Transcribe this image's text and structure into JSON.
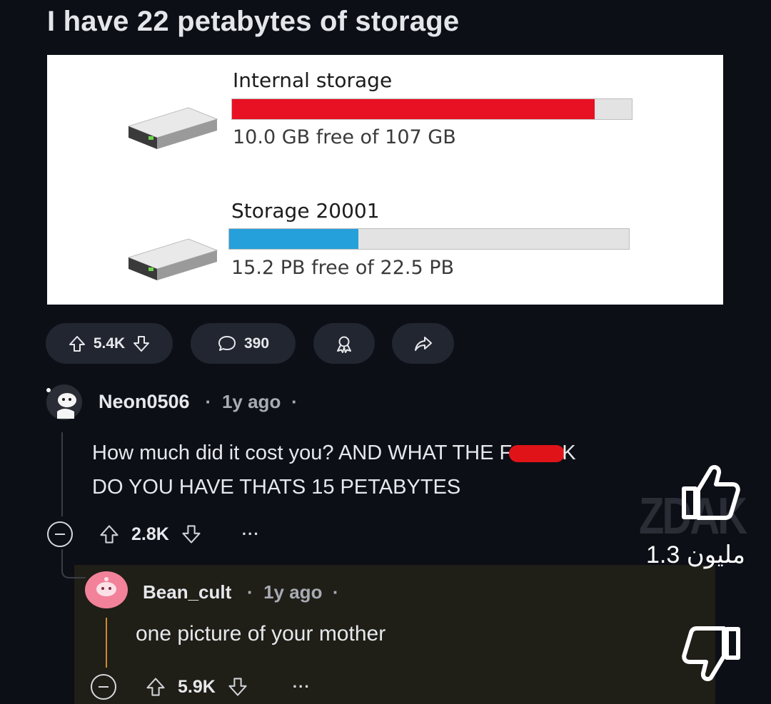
{
  "post": {
    "title": "I have 22 petabytes of storage",
    "image": {
      "drives": [
        {
          "name": "Internal storage",
          "free_text": "10.0 GB free of 107 GB",
          "used_fraction": 0.907,
          "bar_color": "#e81123"
        },
        {
          "name": "Storage 20001",
          "free_text": "15.2 PB free of 22.5 PB",
          "used_fraction": 0.324,
          "bar_color": "#26a0da"
        }
      ]
    },
    "actions": {
      "upvotes": "5.4K",
      "comments": "390",
      "award_icon": "award-icon",
      "share_icon": "share-icon"
    }
  },
  "comments": [
    {
      "username": "Neon0506",
      "time": "1y ago",
      "body_before_redaction": "How much did it cost you? AND WHAT THE F",
      "body_after_redaction": "K",
      "body_line2": "DO YOU HAVE THATS 15 PETABYTES",
      "votes": "2.8K",
      "more": "···",
      "redaction_color": "#e01418"
    },
    {
      "username": "Bean_cult",
      "time": "1y ago",
      "body": "one picture of your mother",
      "votes": "5.9K",
      "more": "···"
    }
  ],
  "overlay": {
    "watermark": "ZDAK",
    "like_count": "1.3 مليون"
  },
  "colors": {
    "background": "#0d0f17",
    "pill": "#222630",
    "reply_highlight": "#1f1e17",
    "internal_bar": "#e81123",
    "storage_bar": "#26a0da"
  }
}
